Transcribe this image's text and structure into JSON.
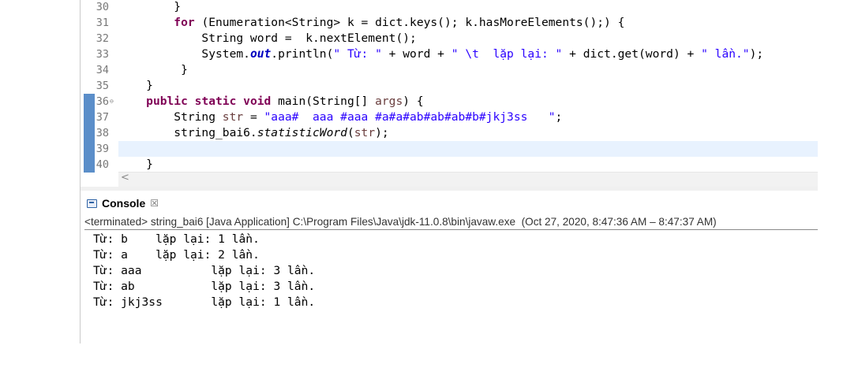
{
  "editor": {
    "line_numbers": [
      "30",
      "31",
      "32",
      "33",
      "34",
      "35",
      "36",
      "37",
      "38",
      "39",
      "40"
    ],
    "lines": [
      [
        {
          "t": "        }",
          "c": ""
        }
      ],
      [
        {
          "t": "        ",
          "c": ""
        },
        {
          "t": "for",
          "c": "kw"
        },
        {
          "t": " (Enumeration<String> k = dict.keys(); k.hasMoreElements();) {",
          "c": ""
        }
      ],
      [
        {
          "t": "            String word =  k.nextElement();",
          "c": ""
        }
      ],
      [
        {
          "t": "            System.",
          "c": ""
        },
        {
          "t": "out",
          "c": "fld"
        },
        {
          "t": ".println(",
          "c": ""
        },
        {
          "t": "\" Từ: \"",
          "c": "str"
        },
        {
          "t": " + word + ",
          "c": ""
        },
        {
          "t": "\" \\t  lặp lại: \"",
          "c": "str"
        },
        {
          "t": " + dict.get(word) + ",
          "c": ""
        },
        {
          "t": "\" lần.\"",
          "c": "str"
        },
        {
          "t": ");",
          "c": ""
        }
      ],
      [
        {
          "t": "         }",
          "c": ""
        }
      ],
      [
        {
          "t": "    }",
          "c": ""
        }
      ],
      [
        {
          "t": "    ",
          "c": ""
        },
        {
          "t": "public static void",
          "c": "kw"
        },
        {
          "t": " main(String[] ",
          "c": ""
        },
        {
          "t": "args",
          "c": "var"
        },
        {
          "t": ") {",
          "c": ""
        }
      ],
      [
        {
          "t": "        String ",
          "c": ""
        },
        {
          "t": "str",
          "c": "var"
        },
        {
          "t": " = ",
          "c": ""
        },
        {
          "t": "\"aaa#  aaa #aaa #a#a#ab#ab#ab#b#jkj3ss   \"",
          "c": "str"
        },
        {
          "t": ";",
          "c": ""
        }
      ],
      [
        {
          "t": "        string_bai6.",
          "c": ""
        },
        {
          "t": "statisticWord",
          "c": "it"
        },
        {
          "t": "(",
          "c": ""
        },
        {
          "t": "str",
          "c": "var"
        },
        {
          "t": ");",
          "c": ""
        }
      ],
      [
        {
          "t": "",
          "c": ""
        }
      ],
      [
        {
          "t": "    }",
          "c": ""
        }
      ]
    ],
    "scroll_left_glyph": "<"
  },
  "console": {
    "title": "Console",
    "close_glyph": "☒",
    "terminated_line": "<terminated> string_bai6 [Java Application] C:\\Program Files\\Java\\jdk-11.0.8\\bin\\javaw.exe  (Oct 27, 2020, 8:47:36 AM – 8:47:37 AM)",
    "output": [
      "Từ: b    lặp lại: 1 lần.",
      "Từ: a    lặp lại: 2 lần.",
      "Từ: aaa          lặp lại: 3 lần.",
      "Từ: ab           lặp lại: 3 lần.",
      "Từ: jkj3ss       lặp lại: 1 lần."
    ]
  },
  "colors": {
    "keyword": "#7f0055",
    "string": "#2a00ff",
    "field": "#0000c0",
    "local_variable": "#6a3e3e",
    "current_line_highlight": "#e8f2fe",
    "change_marker": "#5b8ec9"
  }
}
